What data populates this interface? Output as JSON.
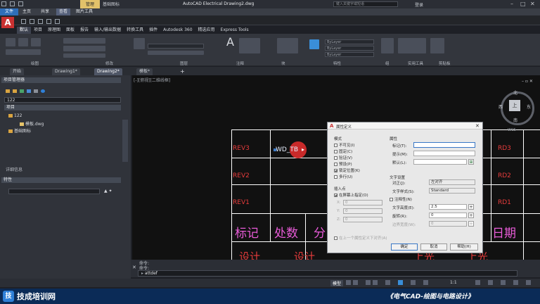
{
  "titlebar": {
    "context_tab": "管理",
    "context_sub": "基础图标",
    "app_title": "AutoCAD Electrical    Drawing2.dwg",
    "search_placeholder": "键入关键字或短语",
    "user_label": "登录"
  },
  "file_tabs": {
    "file": "文件",
    "items": [
      "主页",
      "共享",
      "查看",
      "图片工具"
    ]
  },
  "ribbon": {
    "tabs": [
      "默认",
      "项目",
      "原理图",
      "面板",
      "报告",
      "输入/输出数据",
      "转换工具",
      "插件",
      "Autodesk 360",
      "精选应用",
      "Express Tools"
    ],
    "active_tab_index": 0,
    "panels": [
      "绘图",
      "修改",
      "图层",
      "注释",
      "块",
      "特性",
      "组",
      "实用工具",
      "剪贴板"
    ],
    "layer_combo": "ByLayer",
    "color_combo": "ByLayer",
    "linetype_combo": "ByLayer"
  },
  "doc_tabs": {
    "items": [
      "开始",
      "Drawing1*",
      "Drawing2*",
      "模板*"
    ],
    "active_index": 2,
    "add_label": "+"
  },
  "palette": {
    "header": "项目管理器",
    "project_select": "122",
    "tree_header": "项目",
    "items": [
      {
        "label": "122",
        "level": 0
      },
      {
        "label": "模板.dwg",
        "level": 1
      },
      {
        "label": "基础图标",
        "level": 0
      }
    ],
    "details_label": "详细信息",
    "properties_header": "特性",
    "properties_select": ""
  },
  "canvas": {
    "rev_left": [
      "REV3",
      "REV2",
      "REV1"
    ],
    "rev_right": [
      "RD3",
      "RD2",
      "RD1"
    ],
    "tag": "WD_TB",
    "row_big": [
      "标记",
      "处数",
      "分",
      "日期"
    ],
    "row_bottom": [
      "设计",
      "设计",
      "上光",
      "上光"
    ]
  },
  "viewcube": {
    "north": "北",
    "south": "南",
    "east": "东",
    "west": "西",
    "face": "上",
    "wcs": "WCS"
  },
  "dialog": {
    "title": "属性定义",
    "mode_label": "模式",
    "modes": [
      {
        "label": "不可见(I)",
        "checked": false
      },
      {
        "label": "固定(C)",
        "checked": false
      },
      {
        "label": "验证(V)",
        "checked": false
      },
      {
        "label": "预设(P)",
        "checked": false
      },
      {
        "label": "锁定位置(K)",
        "checked": true
      },
      {
        "label": "多行(U)",
        "checked": false
      }
    ],
    "insert_label": "插入点",
    "onscreen_label": "在屏幕上指定(O)",
    "onscreen_checked": true,
    "x_label": "X:",
    "x_value": "0",
    "y_label": "Y:",
    "y_value": "0",
    "z_label": "Z:",
    "z_value": "0",
    "attr_label": "属性",
    "tag_label": "标记(T):",
    "tag_value": "",
    "prompt_label": "提示(M):",
    "prompt_value": "",
    "default_label": "默认(L):",
    "default_value": "",
    "text_settings_label": "文字设置",
    "justify_label": "对正(J):",
    "justify_value": "左对齐",
    "style_label": "文字样式(S):",
    "style_value": "Standard",
    "annotative_label": "注释性(N)",
    "height_label": "文字高度(E):",
    "height_value": "2.5",
    "rotation_label": "旋转(R):",
    "rotation_value": "0",
    "boundary_label": "边界宽度(W):",
    "boundary_value": "0",
    "align_below_label": "在上一个属性定义下对齐(A)",
    "ok_label": "确定",
    "cancel_label": "取消",
    "help_label": "帮助(H)"
  },
  "command": {
    "history_1": "命令:",
    "history_2": "命令:",
    "current": "attdef"
  },
  "statusbar": {
    "model_label": "模型",
    "scale": "1:1"
  },
  "banner": {
    "logo_text": "技",
    "brand": "技成培训网",
    "course": "《电气CAD-绘图与电路设计》"
  }
}
